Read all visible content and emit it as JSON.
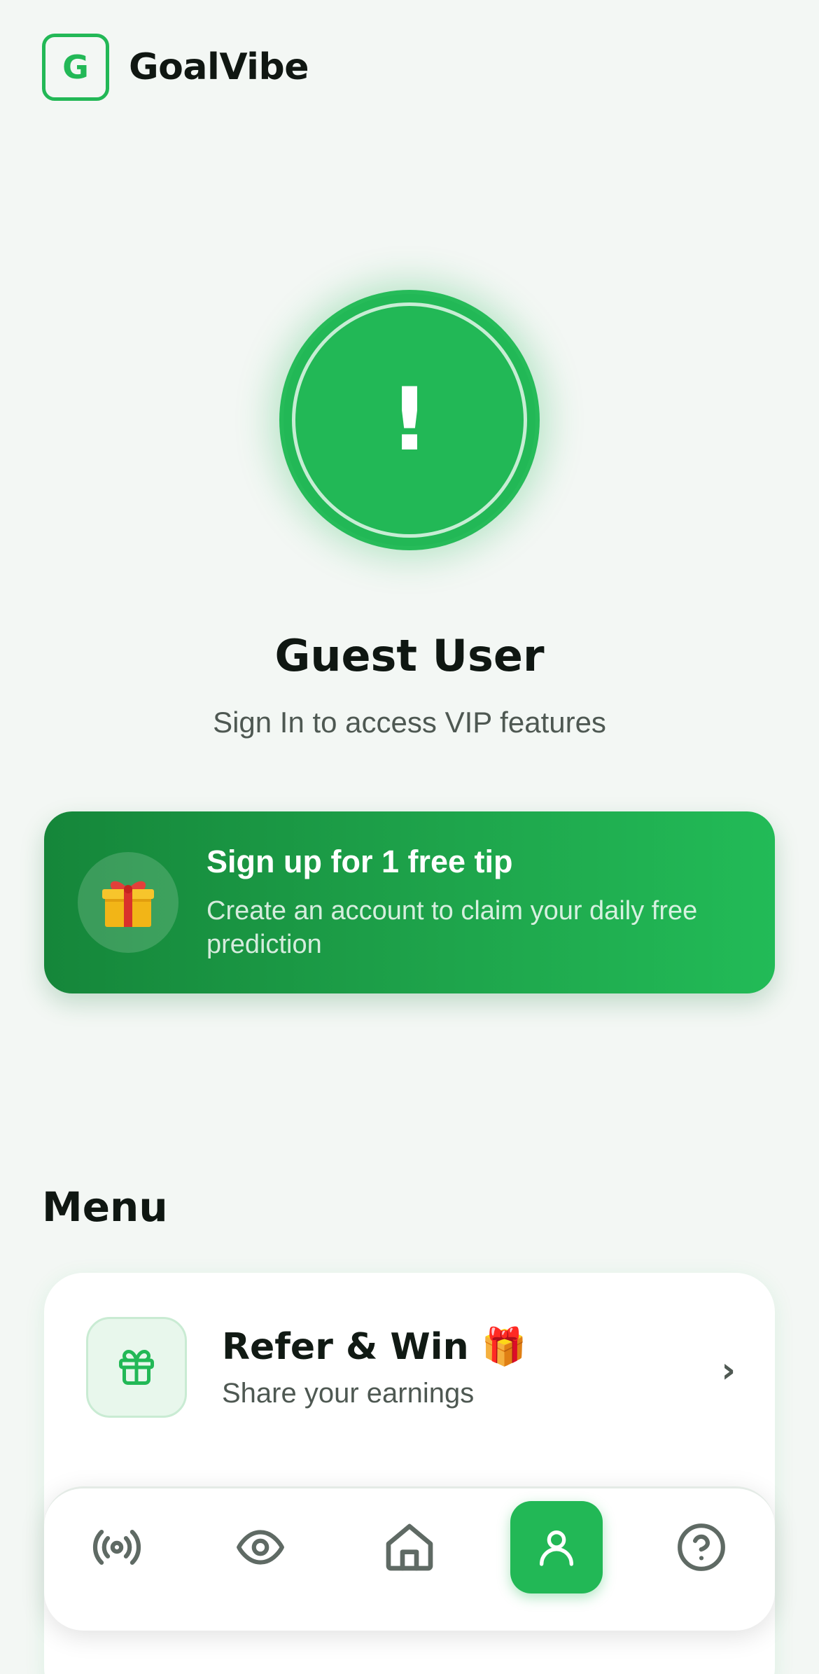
{
  "header": {
    "logo_letter": "G",
    "app_name": "GoalVibe"
  },
  "profile": {
    "alert_icon": "!",
    "name": "Guest User",
    "subtitle": "Sign In to access VIP features"
  },
  "promo": {
    "icon": "gift-emoji",
    "title": "Sign up for 1 free tip",
    "description": "Create an account to claim your daily free prediction"
  },
  "menu": {
    "heading": "Menu",
    "items": [
      {
        "icon": "gift-icon",
        "title": "Refer & Win 🎁",
        "subtitle": "Share your earnings"
      }
    ]
  },
  "bottom_nav": {
    "items": [
      {
        "icon": "live-broadcast-icon",
        "active": false
      },
      {
        "icon": "eye-icon",
        "active": false
      },
      {
        "icon": "home-icon",
        "active": false
      },
      {
        "icon": "profile-icon",
        "active": true
      },
      {
        "icon": "help-icon",
        "active": false
      }
    ]
  },
  "colors": {
    "accent": "#22b856",
    "background": "#f3f7f4",
    "promo_gradient_start": "#15863a",
    "promo_gradient_end": "#22bb57",
    "text_primary": "#111a14",
    "text_secondary": "#4e5852",
    "nav_icon": "#5f6a64"
  }
}
